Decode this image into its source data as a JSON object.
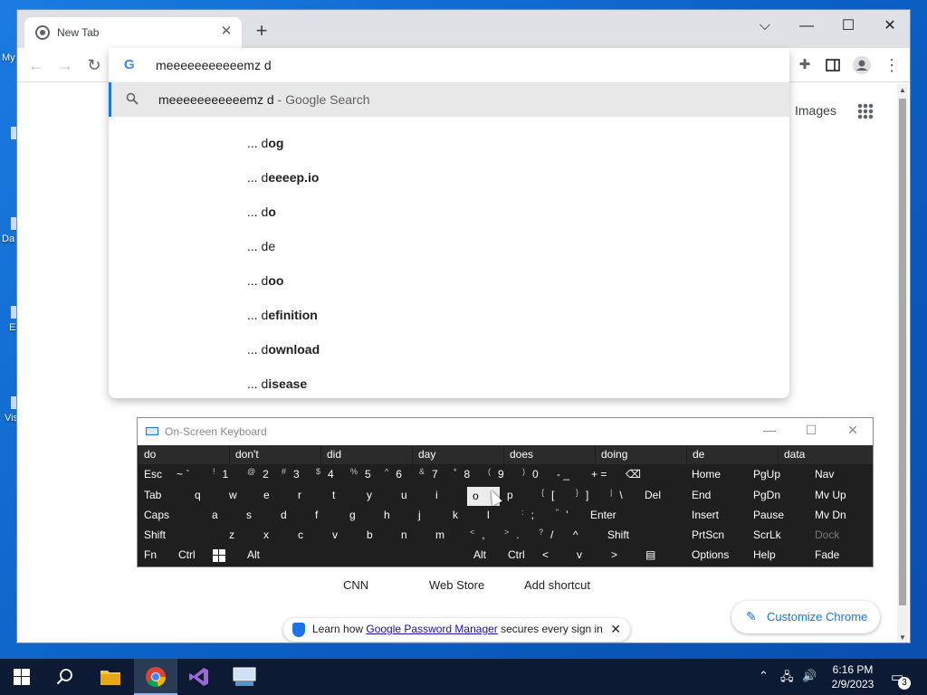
{
  "desktop": {
    "icon_labels": [
      "My",
      "Da",
      "E",
      "Vis"
    ]
  },
  "browser": {
    "tab_title": "New Tab",
    "new_tab_glyph": "+",
    "window_controls": {
      "dropdown": "⌵",
      "minimize": "—",
      "maximize": "☐",
      "close": "✕"
    },
    "omnibox": {
      "value": "meeeeeeeeeeemz d",
      "search_suffix": "- Google Search",
      "suggestions": [
        {
          "prefix": "... d",
          "bold": "og"
        },
        {
          "prefix": "... d",
          "bold": "eeeep.io"
        },
        {
          "prefix": "... d",
          "bold": "o"
        },
        {
          "prefix": "... de",
          "bold": ""
        },
        {
          "prefix": "... d",
          "bold": "oo"
        },
        {
          "prefix": "... d",
          "bold": "efinition"
        },
        {
          "prefix": "... d",
          "bold": "ownload"
        },
        {
          "prefix": "... d",
          "bold": "isease"
        }
      ]
    },
    "images_link": "Images",
    "shortcuts": [
      "CNN",
      "Web Store",
      "Add shortcut"
    ],
    "customize_label": "Customize Chrome",
    "password_bar": {
      "before": "Learn how ",
      "link": "Google Password Manager",
      "after": " secures every sign in"
    }
  },
  "osk": {
    "title": "On-Screen Keyboard",
    "predictions": [
      "do",
      "don't",
      "did",
      "day",
      "does",
      "doing",
      "de",
      "data"
    ],
    "row1": {
      "esc": "Esc",
      "tilde": "~ `",
      "k1": "1",
      "k1s": "!",
      "k2": "2",
      "k2s": "@",
      "k3": "3",
      "k3s": "#",
      "k4": "4",
      "k4s": "$",
      "k5": "5",
      "k5s": "%",
      "k6": "6",
      "k6s": "^",
      "k7": "7",
      "k7s": "&",
      "k8": "8",
      "k8s": "*",
      "k9": "9",
      "k9s": "(",
      "k0": "0",
      "k0s": ")",
      "minus": "- _",
      "plus": "+ =",
      "bksp": "⌫"
    },
    "row2": {
      "tab": "Tab",
      "q": "q",
      "w": "w",
      "e": "e",
      "r": "r",
      "t": "t",
      "y": "y",
      "u": "u",
      "i": "i",
      "o": "o",
      "p": "p",
      "lb": "[",
      "lbs": "{",
      "rb": "]",
      "rbs": "}",
      "bs": "\\",
      "bss": "|",
      "del": "Del"
    },
    "row3": {
      "caps": "Caps",
      "a": "a",
      "s": "s",
      "d": "d",
      "f": "f",
      "g": "g",
      "h": "h",
      "j": "j",
      "k": "k",
      "l": "l",
      "semi": ";",
      "semis": ":",
      "quote": "'",
      "quotes": "\"",
      "enter": "Enter"
    },
    "row4": {
      "shift": "Shift",
      "z": "z",
      "x": "x",
      "c": "c",
      "v": "v",
      "b": "b",
      "n": "n",
      "m": "m",
      "comma": ",",
      "commas": "<",
      "dot": ".",
      "dots": ">",
      "slash": "/",
      "slashs": "?",
      "up": "^",
      "shift_r": "Shift"
    },
    "row5": {
      "fn": "Fn",
      "ctrl": "Ctrl",
      "alt": "Alt",
      "alt_r": "Alt",
      "ctrl_r": "Ctrl",
      "left": "<",
      "down": "v",
      "right": ">"
    },
    "nav": [
      [
        "Home",
        "PgUp",
        "Nav"
      ],
      [
        "End",
        "PgDn",
        "Mv Up"
      ],
      [
        "Insert",
        "Pause",
        "Mv Dn"
      ],
      [
        "PrtScn",
        "ScrLk",
        "Dock"
      ],
      [
        "Options",
        "Help",
        "Fade"
      ]
    ]
  },
  "taskbar": {
    "time": "6:16 PM",
    "date": "2/9/2023",
    "notification_count": "3"
  }
}
